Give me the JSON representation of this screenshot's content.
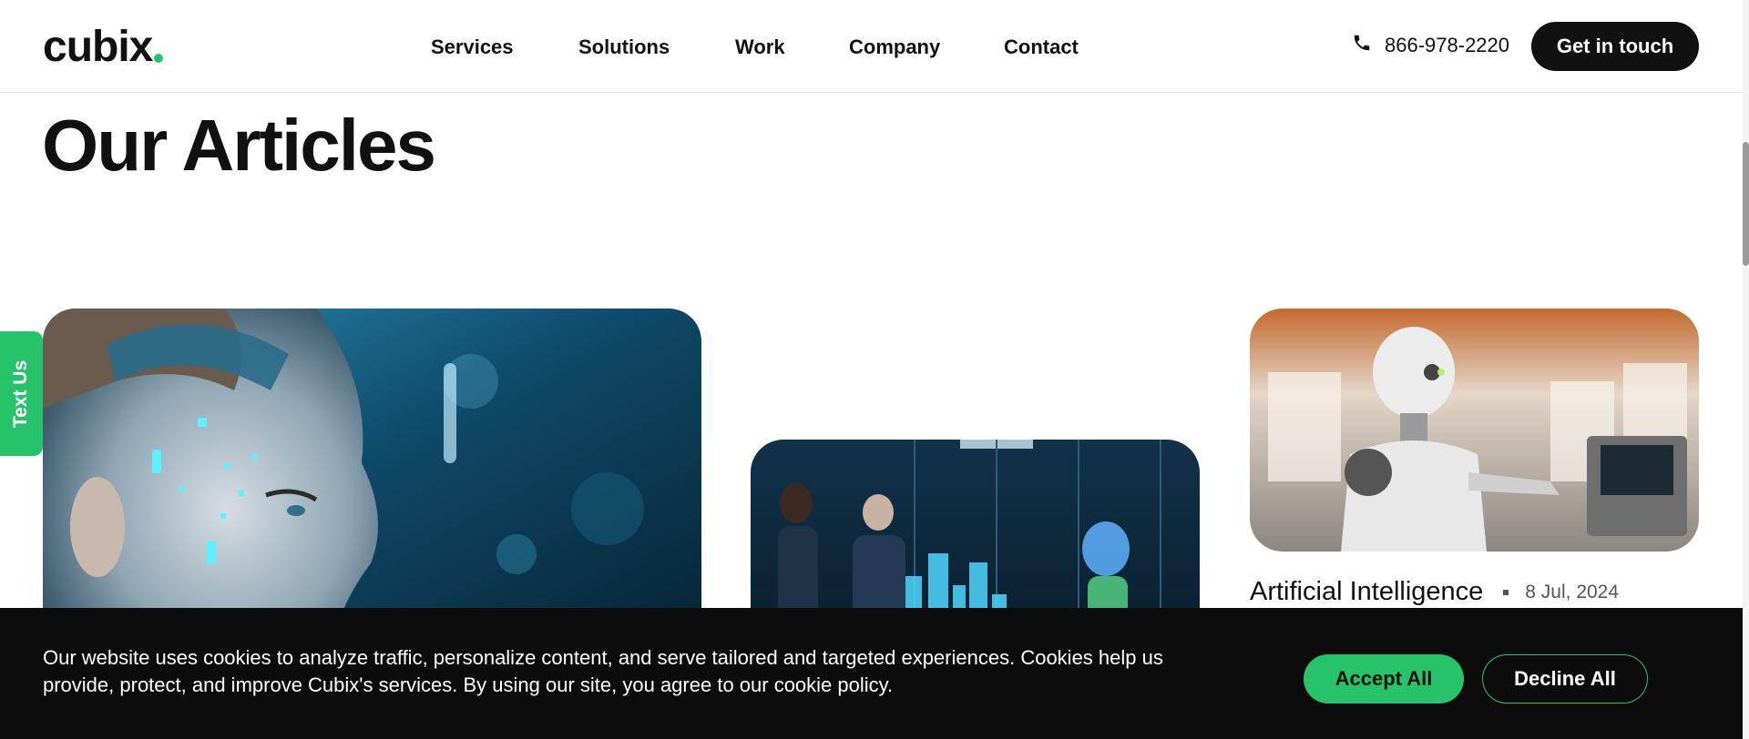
{
  "header": {
    "logo_text": "cubix",
    "nav": [
      {
        "label": "Services"
      },
      {
        "label": "Solutions"
      },
      {
        "label": "Work"
      },
      {
        "label": "Company"
      },
      {
        "label": "Contact"
      }
    ],
    "phone": "866-978-2220",
    "cta_label": "Get in touch"
  },
  "page": {
    "title": "Our Articles"
  },
  "side_tab": {
    "label": "Text Us"
  },
  "articles": [
    {
      "image": "ai-cyborg-woman-profile"
    },
    {
      "image": "office-hologram-meeting"
    },
    {
      "image": "robot-at-store-register",
      "category": "Artificial Intelligence",
      "date": "8 Jul, 2024"
    }
  ],
  "cookie_banner": {
    "text": "Our website uses cookies to analyze traffic, personalize content, and serve tailored and targeted experiences. Cookies help us provide, protect, and improve Cubix's services. By using our site, you agree to our cookie policy.",
    "accept_label": "Accept All",
    "decline_label": "Decline All"
  },
  "colors": {
    "brand_green": "#27c36a",
    "dark": "#111111",
    "banner_bg": "#0c0c0c"
  }
}
